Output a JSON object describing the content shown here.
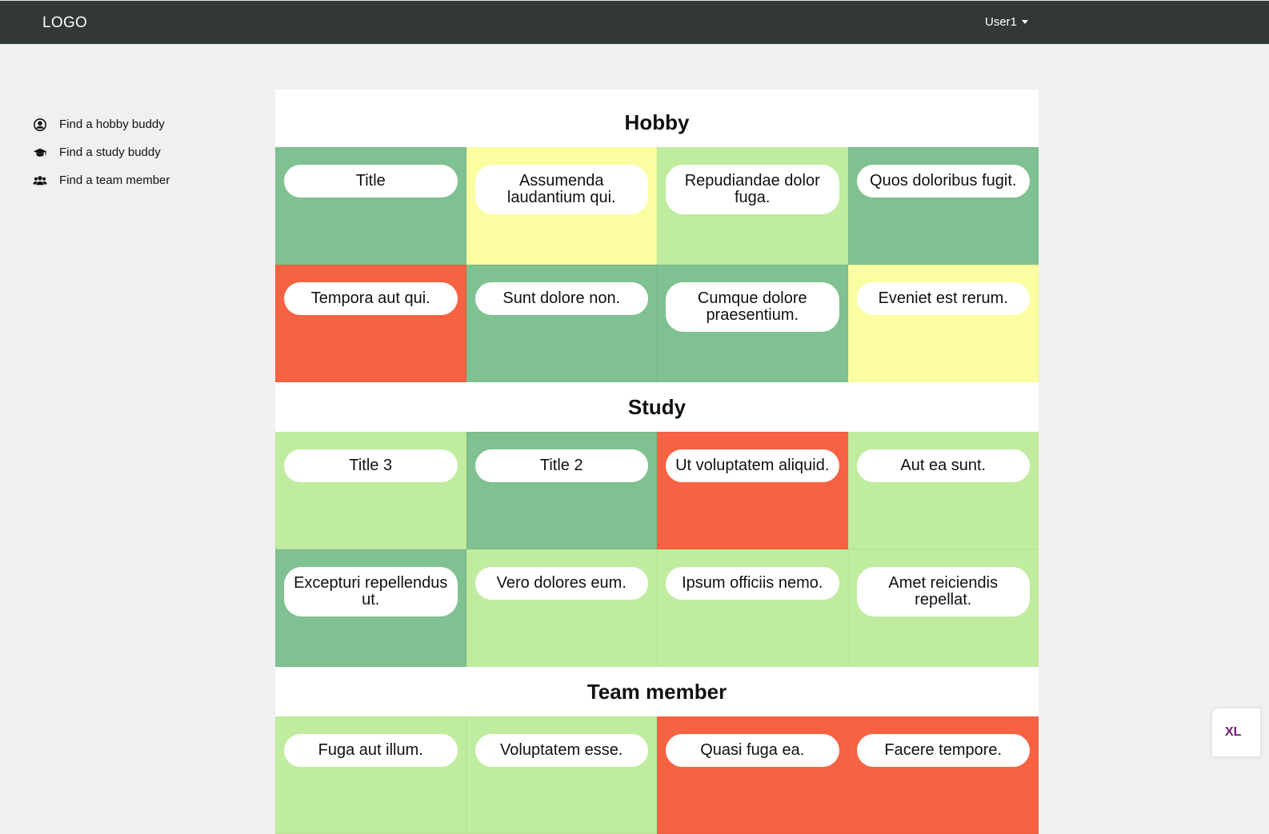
{
  "navbar": {
    "logo": "LOGO",
    "user": "User1"
  },
  "sidebar": {
    "items": [
      {
        "label": "Find a hobby buddy",
        "icon": "user-circle-icon"
      },
      {
        "label": "Find a study buddy",
        "icon": "graduation-cap-icon"
      },
      {
        "label": "Find a team member",
        "icon": "users-icon"
      }
    ]
  },
  "colors": {
    "green": "#7fc190",
    "lightgreen": "#c0ec9f",
    "yellow": "#fbfea0",
    "red": "#f76243"
  },
  "sections": [
    {
      "title": "Hobby",
      "tiles": [
        {
          "text": "Title",
          "color": "green"
        },
        {
          "text": "Assumenda laudantium qui.",
          "color": "yellow"
        },
        {
          "text": "Repudiandae dolor fuga.",
          "color": "lightgreen"
        },
        {
          "text": "Quos doloribus fugit.",
          "color": "green"
        },
        {
          "text": "Tempora aut qui.",
          "color": "red"
        },
        {
          "text": "Sunt dolore non.",
          "color": "green"
        },
        {
          "text": "Cumque dolore praesentium.",
          "color": "green"
        },
        {
          "text": "Eveniet est rerum.",
          "color": "yellow"
        }
      ]
    },
    {
      "title": "Study",
      "tiles": [
        {
          "text": "Title 3",
          "color": "lightgreen"
        },
        {
          "text": "Title 2",
          "color": "green"
        },
        {
          "text": "Ut voluptatem aliquid.",
          "color": "red"
        },
        {
          "text": "Aut ea sunt.",
          "color": "lightgreen"
        },
        {
          "text": "Excepturi repellendus ut.",
          "color": "green"
        },
        {
          "text": "Vero dolores eum.",
          "color": "lightgreen"
        },
        {
          "text": "Ipsum officiis nemo.",
          "color": "lightgreen"
        },
        {
          "text": "Amet reiciendis repellat.",
          "color": "lightgreen"
        }
      ]
    },
    {
      "title": "Team member",
      "tiles": [
        {
          "text": "Fuga aut illum.",
          "color": "lightgreen"
        },
        {
          "text": "Voluptatem esse.",
          "color": "lightgreen"
        },
        {
          "text": "Quasi fuga ea.",
          "color": "red"
        },
        {
          "text": "Facere tempore.",
          "color": "red"
        }
      ]
    }
  ],
  "badge": "XL"
}
